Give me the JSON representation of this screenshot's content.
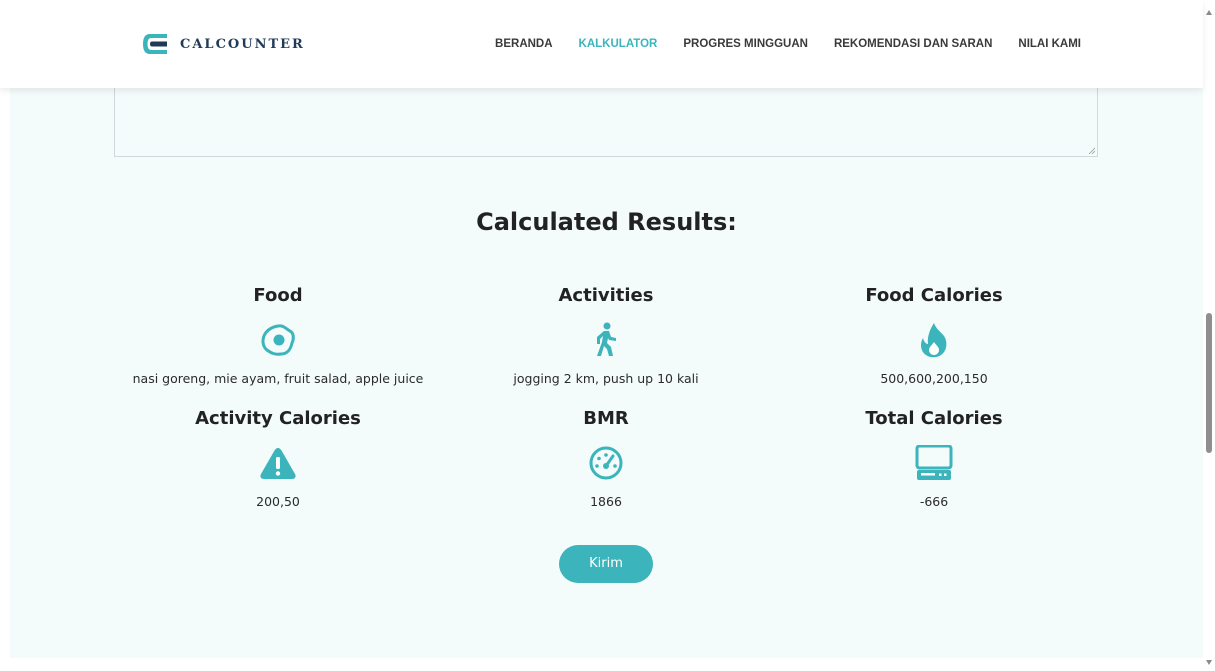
{
  "app": {
    "logo_text": "CALCOUNTER"
  },
  "nav": {
    "items": [
      {
        "label": "BERANDA",
        "active": false
      },
      {
        "label": "KALKULATOR",
        "active": true
      },
      {
        "label": "PROGRES MINGGUAN",
        "active": false
      },
      {
        "label": "REKOMENDASI DAN SARAN",
        "active": false
      },
      {
        "label": "NILAI KAMI",
        "active": false
      }
    ]
  },
  "results": {
    "title": "Calculated Results:",
    "items": [
      {
        "title": "Food",
        "icon": "fried-egg-icon",
        "value": "nasi goreng, mie ayam, fruit salad, apple juice"
      },
      {
        "title": "Activities",
        "icon": "walking-person-icon",
        "value": "jogging 2 km, push up 10 kali"
      },
      {
        "title": "Food Calories",
        "icon": "fire-icon",
        "value": "500,600,200,150"
      },
      {
        "title": "Activity Calories",
        "icon": "warning-icon",
        "value": "200,50"
      },
      {
        "title": "BMR",
        "icon": "gauge-icon",
        "value": "1866"
      },
      {
        "title": "Total Calories",
        "icon": "computer-icon",
        "value": "-666"
      }
    ],
    "submit_label": "Kirim"
  },
  "colors": {
    "accent": "#3bb4bc",
    "section_bg": "#f4fbfb",
    "logo_dark": "#1f3b57"
  }
}
